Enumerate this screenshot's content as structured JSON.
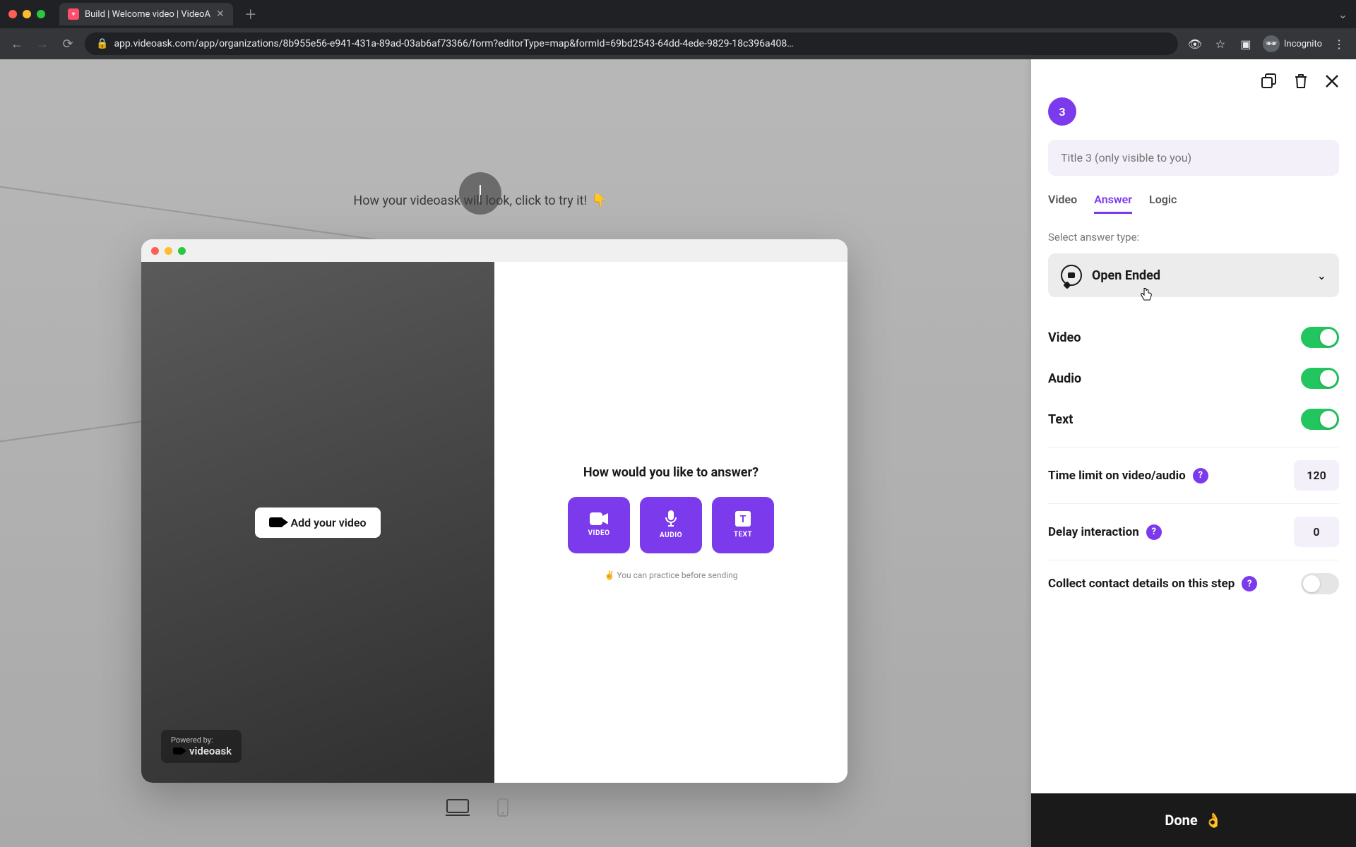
{
  "browser": {
    "tab_title": "Build | Welcome video | VideoA",
    "url": "app.videoask.com/app/organizations/8b955e56-e941-431a-89ad-03ab6af73366/form?editorType=map&formId=69bd2543-64dd-4ede-9829-18c396a408…",
    "incognito_label": "Incognito"
  },
  "canvas": {
    "hint_text": "How your videoask will look, click to try it!",
    "hint_emoji": "👇"
  },
  "preview": {
    "add_video_label": "Add your video",
    "powered_line1": "Powered by:",
    "powered_line2": "videoask",
    "answer_prompt": "How would you like to answer?",
    "buttons": {
      "video": "VIDEO",
      "audio": "AUDIO",
      "text": "TEXT"
    },
    "practice_hint": "✌️ You can practice before sending"
  },
  "panel": {
    "step_number": "3",
    "title_placeholder": "Title 3 (only visible to you)",
    "tabs": {
      "video": "Video",
      "answer": "Answer",
      "logic": "Logic"
    },
    "select_label": "Select answer type:",
    "answer_type": "Open Ended",
    "toggles": {
      "video_label": "Video",
      "audio_label": "Audio",
      "text_label": "Text"
    },
    "time_limit_label": "Time limit on video/audio",
    "time_limit_value": "120",
    "delay_label": "Delay interaction",
    "delay_value": "0",
    "collect_label": "Collect contact details on this step",
    "done_label": "Done",
    "done_emoji": "👌"
  }
}
